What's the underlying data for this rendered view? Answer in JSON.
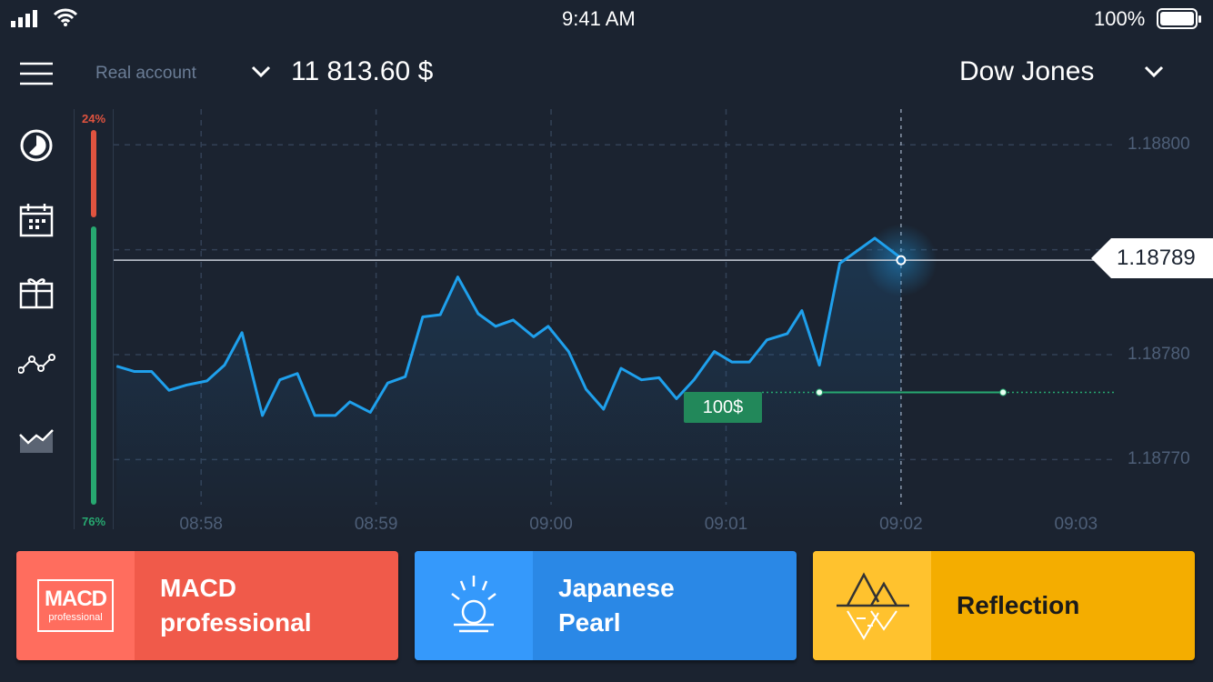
{
  "status_bar": {
    "time": "9:41 AM",
    "battery": "100%"
  },
  "header": {
    "account_label": "Real account",
    "balance": "11 813.60 $",
    "asset": "Dow Jones"
  },
  "sidebar": {
    "icons": [
      "clock-icon",
      "calendar-icon",
      "gift-icon",
      "line-indicator-icon",
      "area-chart-icon"
    ]
  },
  "sentiment": {
    "down_pct": "24%",
    "up_pct": "76%",
    "down_value": 24,
    "up_value": 76,
    "down_color": "#e0533f",
    "up_color": "#27a870"
  },
  "chart_data": {
    "type": "line",
    "x_ticks": [
      "08:58",
      "08:59",
      "09:00",
      "09:01",
      "09:02",
      "09:03"
    ],
    "y_ticks": [
      "1.18800",
      "1.18780",
      "1.18770"
    ],
    "y_grid": [
      1.188,
      1.1879,
      1.1878,
      1.1877
    ],
    "xlim": [
      "08:57:30",
      "09:03:13"
    ],
    "ylim": [
      1.187631,
      1.188034
    ],
    "grid": true,
    "line_color": "#1fa0ec",
    "x": [
      "08:57:31",
      "08:57:37",
      "08:57:43",
      "08:57:49",
      "08:57:55",
      "08:58:02",
      "08:58:08",
      "08:58:14",
      "08:58:21",
      "08:58:27",
      "08:58:33",
      "08:58:39",
      "08:58:46",
      "08:58:51",
      "08:58:58",
      "08:59:04",
      "08:59:10",
      "08:59:16",
      "08:59:22",
      "08:59:28",
      "08:59:35",
      "08:59:41",
      "08:59:47",
      "08:59:54",
      "08:59:59",
      "09:00:06",
      "09:00:12",
      "09:00:18",
      "09:00:24",
      "09:00:31",
      "09:00:37",
      "09:00:43",
      "09:00:49",
      "09:00:56",
      "09:01:02",
      "09:01:08",
      "09:01:14",
      "09:01:21",
      "09:01:26",
      "09:01:32",
      "09:01:39",
      "09:01:51",
      "09:02:00"
    ],
    "y": [
      1.187789,
      1.187784,
      1.187784,
      1.187766,
      1.187771,
      1.187775,
      1.18779,
      1.187821,
      1.187742,
      1.187776,
      1.187782,
      1.187742,
      1.187742,
      1.187755,
      1.187745,
      1.187773,
      1.187779,
      1.187836,
      1.187838,
      1.187874,
      1.187839,
      1.187827,
      1.187833,
      1.187817,
      1.187827,
      1.187803,
      1.187767,
      1.187748,
      1.187787,
      1.187776,
      1.187778,
      1.187758,
      1.187776,
      1.187803,
      1.187793,
      1.187793,
      1.187814,
      1.18782,
      1.187842,
      1.18779,
      1.187887,
      1.187911,
      1.187892
    ],
    "current_price": "1.18789",
    "current_value": 1.18789,
    "current_time": "09:02:00",
    "trade": {
      "label": "100$",
      "price": 1.187764,
      "start": "09:01:32",
      "end": "09:02:35",
      "color": "#27a870"
    }
  },
  "strategies": [
    {
      "title": "MACD\nprofessional",
      "icon": "macd-icon",
      "logo_text": "MACD",
      "logo_sub": "professional",
      "color": "#f05a4a",
      "icon_bg": "#ff6d5e"
    },
    {
      "title": "Japanese\nPearl",
      "icon": "sunrise-pearl-icon",
      "color": "#2a88e6",
      "icon_bg": "#3599fb"
    },
    {
      "title": "Reflection",
      "icon": "mountain-reflection-icon",
      "color": "#f4ad00",
      "icon_bg": "#ffc22e"
    }
  ]
}
